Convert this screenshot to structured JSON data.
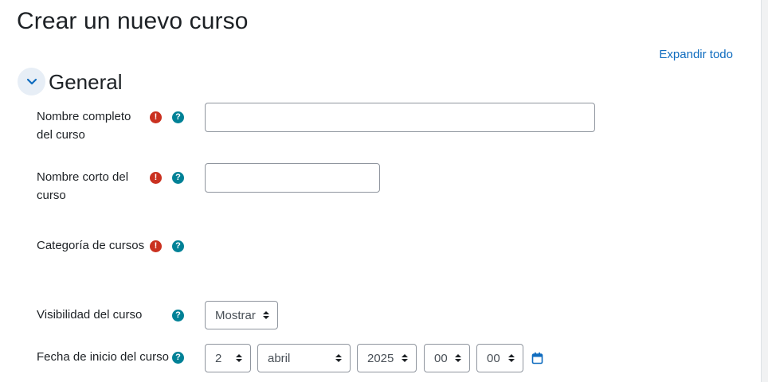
{
  "page": {
    "title": "Crear un nuevo curso"
  },
  "toolbar": {
    "expand_all": "Expandir todo"
  },
  "section": {
    "title": "General"
  },
  "fields": {
    "fullname": {
      "label_line1": "Nombre completo",
      "label_line2": "del curso",
      "value": ""
    },
    "shortname": {
      "label_line1": "Nombre corto del",
      "label_line2": "curso",
      "value": ""
    },
    "category": {
      "label": "Categoría de cursos"
    },
    "visibility": {
      "label": "Visibilidad del curso",
      "value": "Mostrar"
    },
    "startdate": {
      "label": "Fecha de inicio del curso",
      "day": "2",
      "month": "abril",
      "year": "2025",
      "hour": "00",
      "minute": "00"
    }
  },
  "icons": {
    "required": "exclamation-circle-icon",
    "help": "question-circle-icon",
    "calendar": "calendar-icon",
    "toggle": "chevron-down-icon"
  },
  "colors": {
    "link": "#0f6cbf",
    "required": "#ca3120",
    "help": "#008196"
  }
}
